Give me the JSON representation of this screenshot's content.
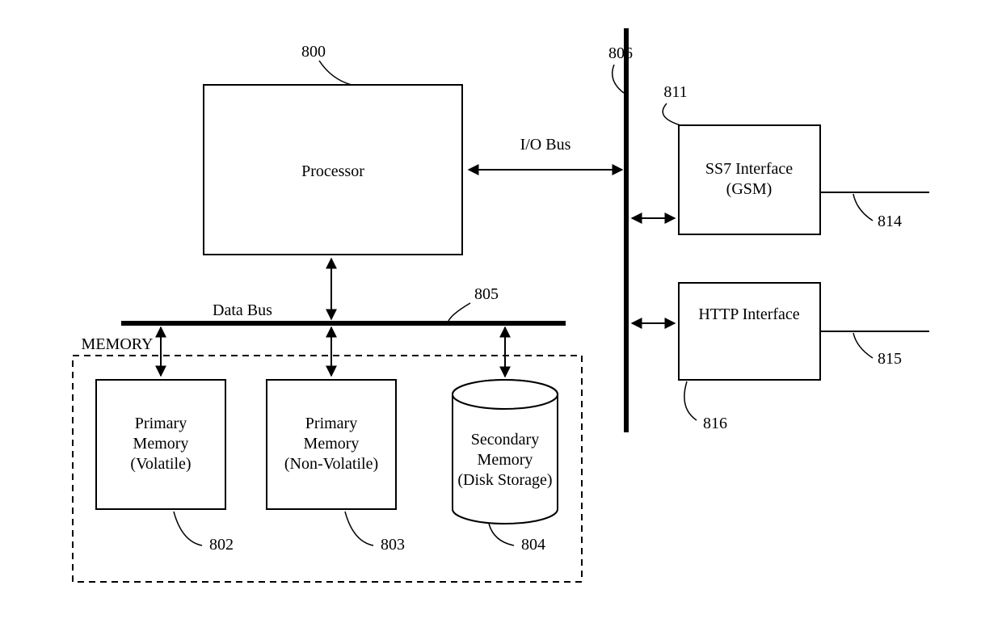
{
  "diagram": {
    "processor": {
      "label": "Processor",
      "ref": "800"
    },
    "io_bus": {
      "label": "I/O Bus",
      "ref": "806"
    },
    "data_bus": {
      "label": "Data Bus",
      "ref": "805"
    },
    "memory_group": {
      "label": "MEMORY"
    },
    "primary_volatile": {
      "line1": "Primary",
      "line2": "Memory",
      "line3": "(Volatile)",
      "ref": "802"
    },
    "primary_nonvolatile": {
      "line1": "Primary",
      "line2": "Memory",
      "line3": "(Non-Volatile)",
      "ref": "803"
    },
    "secondary": {
      "line1": "Secondary",
      "line2": "Memory",
      "line3": "(Disk Storage)",
      "ref": "804"
    },
    "ss7": {
      "line1": "SS7 Interface",
      "line2": "(GSM)",
      "ref": "811",
      "ext_ref": "814"
    },
    "http": {
      "line1": "HTTP Interface",
      "ref": "816",
      "ext_ref": "815"
    }
  }
}
